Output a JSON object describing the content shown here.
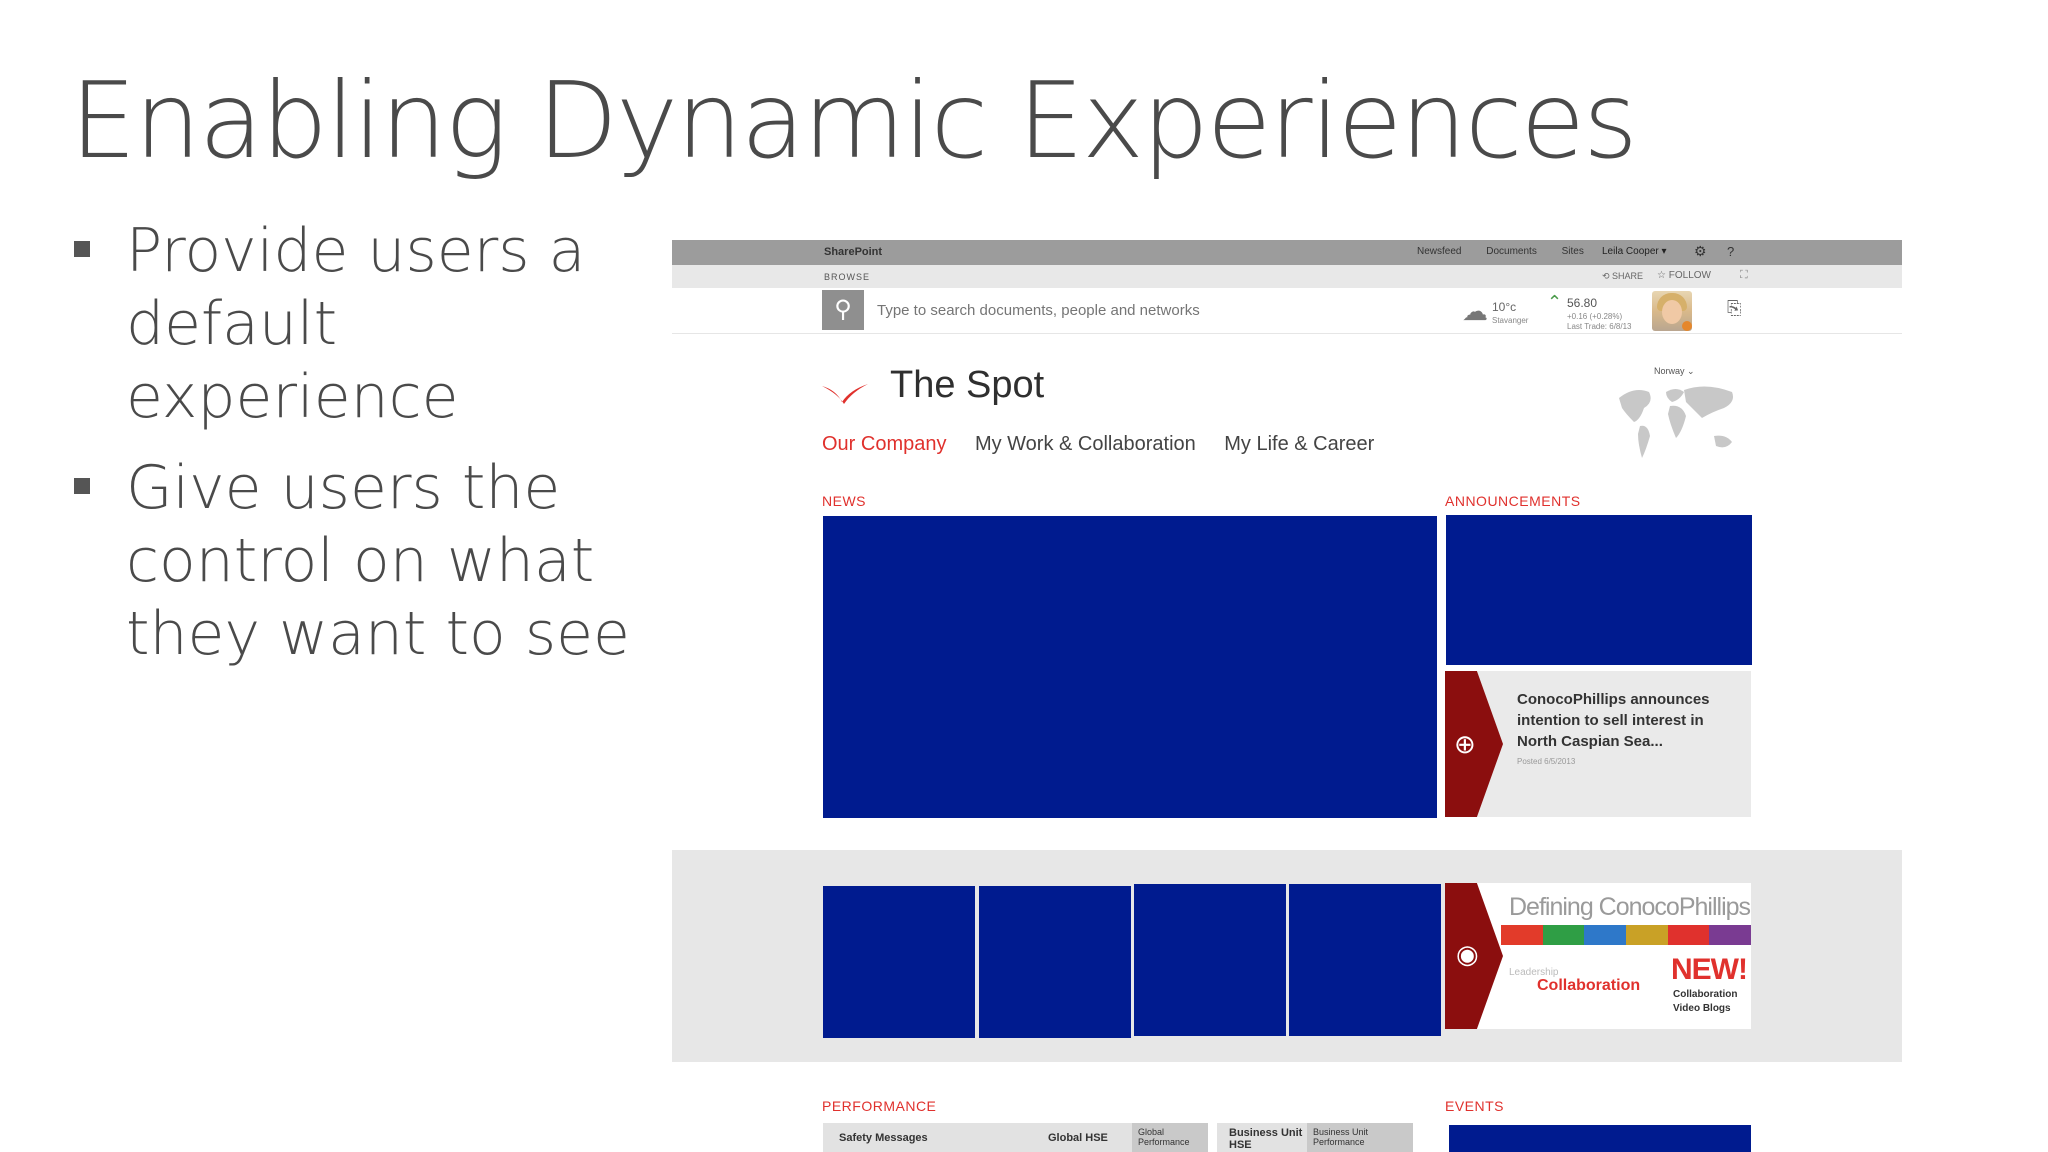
{
  "slide": {
    "title": "Enabling Dynamic Experiences",
    "bullets": [
      "Provide users a default experience",
      "Give users the control on what they want to see"
    ]
  },
  "sharepoint": {
    "suite_bar": {
      "brand": "SharePoint",
      "links": [
        "Newsfeed",
        "Documents",
        "Sites"
      ],
      "user": "Leila Cooper ▾"
    },
    "ribbon": {
      "browse": "BROWSE",
      "share": "SHARE",
      "follow": "FOLLOW"
    },
    "search": {
      "placeholder": "Type to search documents, people and networks"
    },
    "weather": {
      "temperature": "10°c",
      "city": "Stavanger"
    },
    "stock": {
      "price": "56.80",
      "change": "+0.16 (+0.28%)",
      "last_trade": "Last Trade: 6/8/13"
    },
    "site_title": "The Spot",
    "region": "Norway",
    "nav": [
      "Our Company",
      "My Work & Collaboration",
      "My Life & Career"
    ],
    "sections": {
      "news": "NEWS",
      "announcements": "ANNOUNCEMENTS",
      "performance": "PERFORMANCE",
      "events": "EVENTS"
    },
    "announcement": {
      "headline": "ConocoPhillips announces intention to sell interest in North Caspian Sea...",
      "posted": "Posted 6/5/2013"
    },
    "promo": {
      "title": "Defining ConocoPhillips",
      "leadership": "Leadership",
      "collaboration": "Collaboration",
      "new_badge": "NEW!",
      "sub1": "Collaboration",
      "sub2": "Video Blogs",
      "stripe_colors": [
        "#e23b2a",
        "#2f9e45",
        "#2e78c9",
        "#c9a126",
        "#e0312d",
        "#7a3b92"
      ]
    },
    "performance": {
      "items": [
        "Safety Messages",
        "Global HSE",
        "Global Performance",
        "Business Unit HSE",
        "Business Unit Performance"
      ]
    },
    "colors": {
      "accent": "#e0312d",
      "redacted_block": "#001b8f",
      "tab_red": "#8b0e0e"
    }
  }
}
